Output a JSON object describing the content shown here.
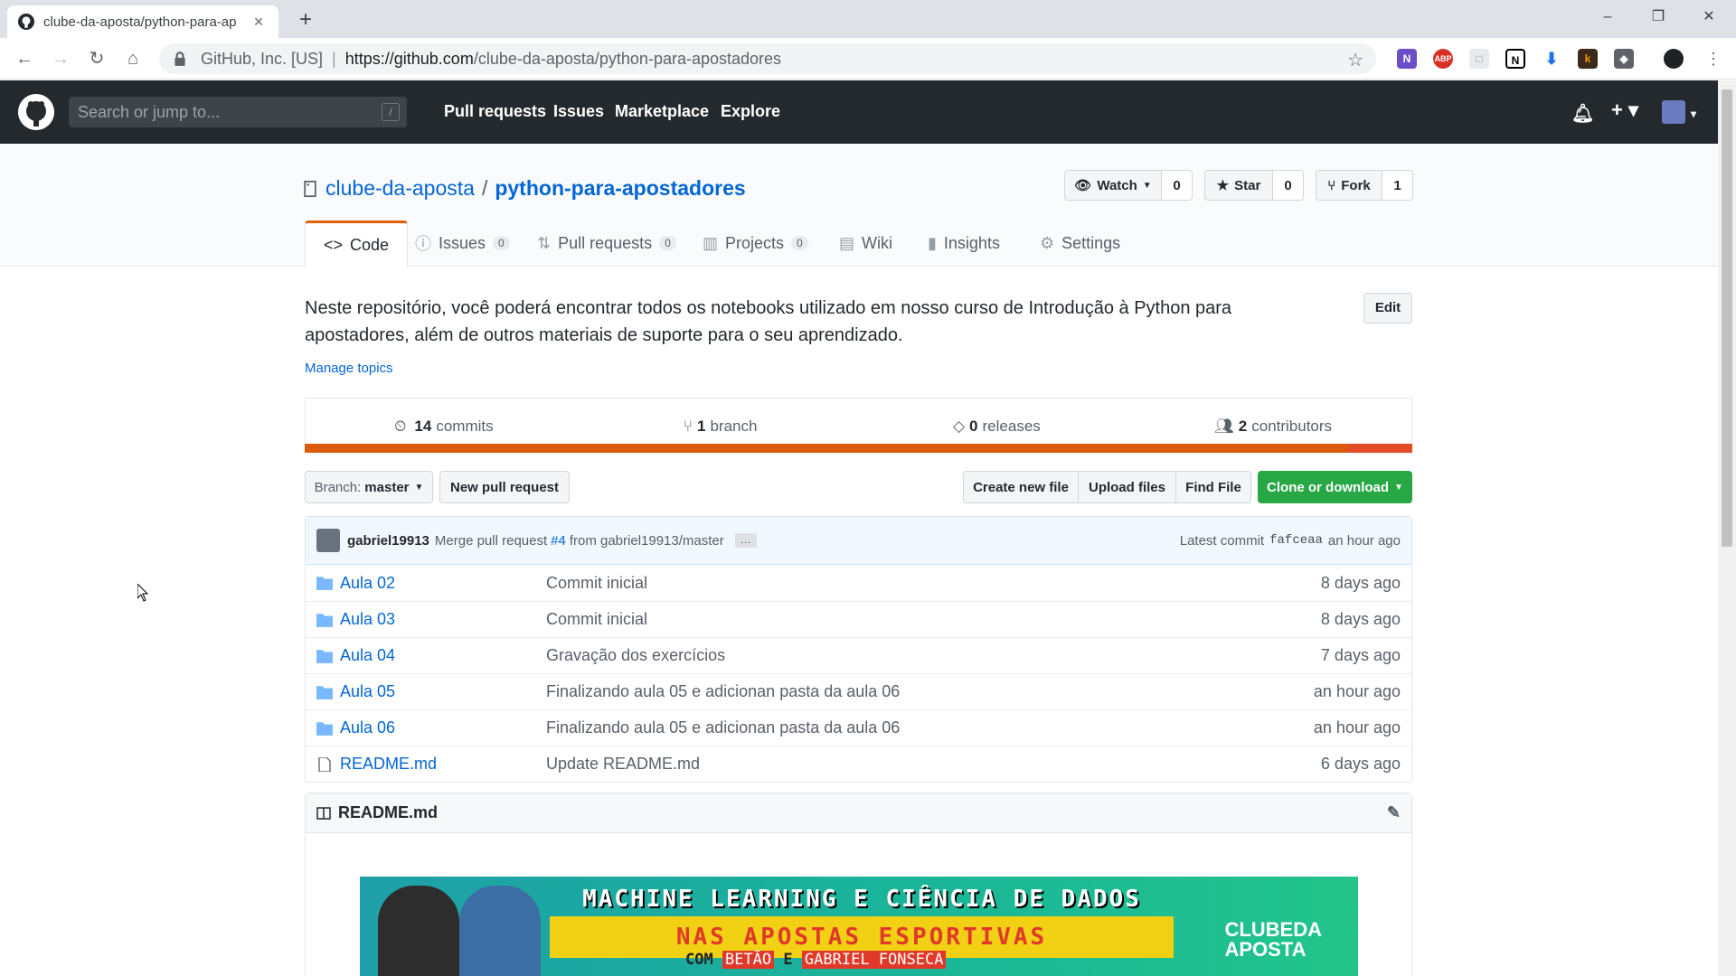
{
  "browser": {
    "tab_title": "clube-da-aposta/python-para-ap",
    "close": "×",
    "new_tab": "+",
    "origin": "GitHub, Inc. [US]",
    "url_host": "https://github.com",
    "url_path": "/clube-da-aposta/python-para-apostadores",
    "win_min": "–",
    "win_restore": "❐",
    "win_close": "✕"
  },
  "github": {
    "search_placeholder": "Search or jump to...",
    "search_key": "/",
    "nav": [
      "Pull requests",
      "Issues",
      "Marketplace",
      "Explore"
    ]
  },
  "repo": {
    "owner": "clube-da-aposta",
    "separator": "/",
    "name": "python-para-apostadores",
    "watch_label": "Watch",
    "watch_count": "0",
    "star_label": "Star",
    "star_count": "0",
    "fork_label": "Fork",
    "fork_count": "1",
    "tabs": [
      {
        "label": "Code"
      },
      {
        "label": "Issues",
        "count": "0"
      },
      {
        "label": "Pull requests",
        "count": "0"
      },
      {
        "label": "Projects",
        "count": "0"
      },
      {
        "label": "Wiki"
      },
      {
        "label": "Insights"
      },
      {
        "label": "Settings"
      }
    ],
    "description": "Neste repositório, você poderá encontrar todos os notebooks utilizado em nosso curso de Introdução à Python para apostadores, além de outros materiais de suporte para o seu aprendizado.",
    "edit_label": "Edit",
    "manage_topics": "Manage topics",
    "summary": {
      "commits_count": "14",
      "commits_label": "commits",
      "branch_count": "1",
      "branch_label": "branch",
      "releases_count": "0",
      "releases_label": "releases",
      "contributors_count": "2",
      "contributors_label": "contributors"
    },
    "lang_colors": [
      "#DA5B0B",
      "#e34c26"
    ],
    "branch_label": "Branch:",
    "branch_name": "master",
    "new_pr": "New pull request",
    "create_file": "Create new file",
    "upload_files": "Upload files",
    "find_file": "Find File",
    "clone": "Clone or download",
    "latest_commit": {
      "user": "gabriel19913",
      "msg_prefix": "Merge pull request",
      "pr": "#4",
      "msg_suffix": "from gabriel19913/master",
      "ellipsis": "…",
      "label": "Latest commit",
      "sha": "fafceaa",
      "age": "an hour ago"
    },
    "files": [
      {
        "name": "Aula 02",
        "type": "dir",
        "message": "Commit inicial",
        "age": "8 days ago"
      },
      {
        "name": "Aula 03",
        "type": "dir",
        "message": "Commit inicial",
        "age": "8 days ago"
      },
      {
        "name": "Aula 04",
        "type": "dir",
        "message": "Gravação dos exercícios",
        "age": "7 days ago"
      },
      {
        "name": "Aula 05",
        "type": "dir",
        "message": "Finalizando aula 05 e adicionan pasta da aula 06",
        "age": "an hour ago"
      },
      {
        "name": "Aula 06",
        "type": "dir",
        "message": "Finalizando aula 05 e adicionan pasta da aula 06",
        "age": "an hour ago"
      },
      {
        "name": "README.md",
        "type": "file",
        "message": "Update README.md",
        "age": "6 days ago"
      }
    ],
    "readme_title": "README.md",
    "banner": {
      "line1": "MACHINE LEARNING E CIÊNCIA DE DADOS",
      "line2": "NAS APOSTAS ESPORTIVAS",
      "line3_prefix": "COM",
      "name1": "BETÃO",
      "line3_mid": "E",
      "name2": "GABRIEL FONSECA",
      "brand1": "CLUBEDA",
      "brand2": "APOSTA"
    }
  }
}
